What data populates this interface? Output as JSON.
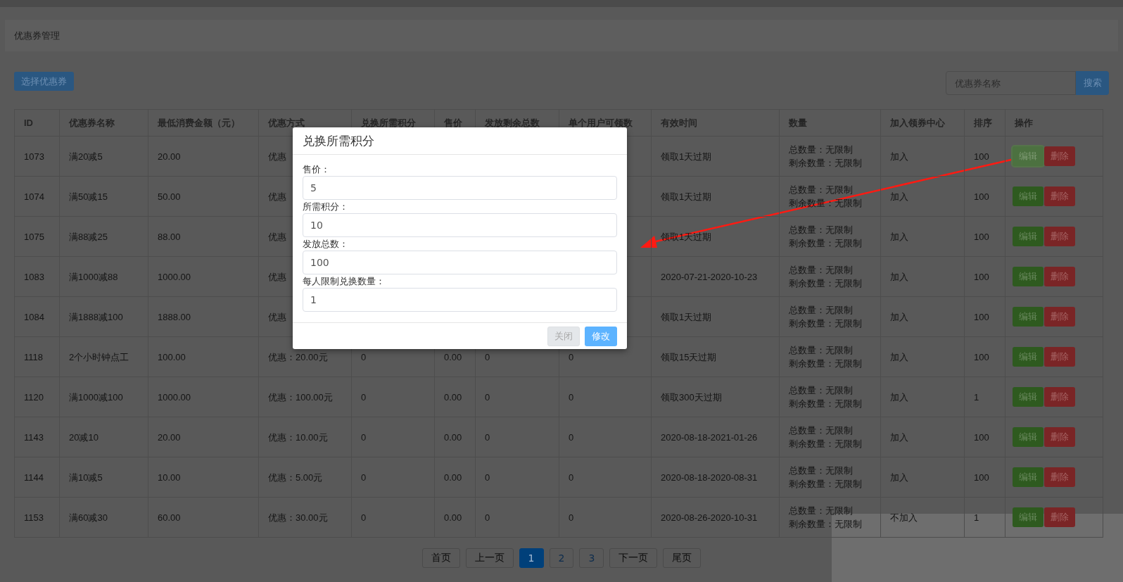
{
  "page_title": "优惠券管理",
  "toolbar": {
    "select_button": "选择优惠券",
    "search": {
      "placeholder": "优惠券名称",
      "button": "搜索"
    }
  },
  "table": {
    "columns": [
      "ID",
      "优惠券名称",
      "最低消费金额（元）",
      "优惠方式",
      "兑换所需积分",
      "售价",
      "发放剩余总数",
      "单个用户可领数",
      "有效时间",
      "数量",
      "加入领券中心",
      "排序",
      "操作"
    ],
    "rows": [
      {
        "id": "1073",
        "name": "满20减5",
        "min_amount": "20.00",
        "discount": "优惠",
        "valid": "领取1天过期",
        "quantity": [
          "总数量：无限制",
          "剩余数量：无限制"
        ],
        "join_center": "加入",
        "sort": "100",
        "actions": [
          {
            "label": "编辑",
            "kind": "edit",
            "focused": true
          },
          {
            "label": "删除",
            "kind": "delete",
            "focused": false
          }
        ]
      },
      {
        "id": "1074",
        "name": "满50减15",
        "min_amount": "50.00",
        "discount": "优惠",
        "valid": "领取1天过期",
        "quantity": [
          "总数量：无限制",
          "剩余数量：无限制"
        ],
        "join_center": "加入",
        "sort": "100",
        "actions": [
          {
            "label": "编辑",
            "kind": "edit",
            "focused": false
          },
          {
            "label": "删除",
            "kind": "delete",
            "focused": false
          }
        ]
      },
      {
        "id": "1075",
        "name": "满88减25",
        "min_amount": "88.00",
        "discount": "优惠",
        "valid": "领取1天过期",
        "quantity": [
          "总数量：无限制",
          "剩余数量：无限制"
        ],
        "join_center": "加入",
        "sort": "100",
        "actions": [
          {
            "label": "编辑",
            "kind": "edit",
            "focused": false
          },
          {
            "label": "删除",
            "kind": "delete",
            "focused": false
          }
        ]
      },
      {
        "id": "1083",
        "name": "满1000减88",
        "min_amount": "1000.00",
        "discount": "优惠",
        "valid": "2020-07-21-2020-10-23",
        "quantity": [
          "总数量：无限制",
          "剩余数量：无限制"
        ],
        "join_center": "加入",
        "sort": "100",
        "actions": [
          {
            "label": "编辑",
            "kind": "edit",
            "focused": false
          },
          {
            "label": "删除",
            "kind": "delete",
            "focused": false
          }
        ]
      },
      {
        "id": "1084",
        "name": "满1888减100",
        "min_amount": "1888.00",
        "discount": "优惠",
        "valid": "领取1天过期",
        "quantity": [
          "总数量：无限制",
          "剩余数量：无限制"
        ],
        "join_center": "加入",
        "sort": "100",
        "actions": [
          {
            "label": "编辑",
            "kind": "edit",
            "focused": false
          },
          {
            "label": "删除",
            "kind": "delete",
            "focused": false
          }
        ]
      },
      {
        "id": "1118",
        "name": "2个小时钟点工",
        "min_amount": "100.00",
        "discount": "优惠：20.00元",
        "points": "0",
        "price": "0.00",
        "remaining": "0",
        "per_user": "0",
        "valid": "领取15天过期",
        "quantity": [
          "总数量：无限制",
          "剩余数量：无限制"
        ],
        "join_center": "加入",
        "sort": "100",
        "actions": [
          {
            "label": "编辑",
            "kind": "edit",
            "focused": false
          },
          {
            "label": "删除",
            "kind": "delete",
            "focused": false
          }
        ]
      },
      {
        "id": "1120",
        "name": "满1000减100",
        "min_amount": "1000.00",
        "discount": "优惠：100.00元",
        "points": "0",
        "price": "0.00",
        "remaining": "0",
        "per_user": "0",
        "valid": "领取300天过期",
        "quantity": [
          "总数量：无限制",
          "剩余数量：无限制"
        ],
        "join_center": "加入",
        "sort": "1",
        "actions": [
          {
            "label": "编辑",
            "kind": "edit",
            "focused": false
          },
          {
            "label": "删除",
            "kind": "delete",
            "focused": false
          }
        ]
      },
      {
        "id": "1143",
        "name": "20减10",
        "min_amount": "20.00",
        "discount": "优惠：10.00元",
        "points": "0",
        "price": "0.00",
        "remaining": "0",
        "per_user": "0",
        "valid": "2020-08-18-2021-01-26",
        "quantity": [
          "总数量：无限制",
          "剩余数量：无限制"
        ],
        "join_center": "加入",
        "sort": "100",
        "actions": [
          {
            "label": "编辑",
            "kind": "edit",
            "focused": false
          },
          {
            "label": "删除",
            "kind": "delete",
            "focused": false
          }
        ]
      },
      {
        "id": "1144",
        "name": "满10减5",
        "min_amount": "10.00",
        "discount": "优惠：5.00元",
        "points": "0",
        "price": "0.00",
        "remaining": "0",
        "per_user": "0",
        "valid": "2020-08-18-2020-08-31",
        "quantity": [
          "总数量：无限制",
          "剩余数量：无限制"
        ],
        "join_center": "加入",
        "sort": "100",
        "actions": [
          {
            "label": "编辑",
            "kind": "edit",
            "focused": false
          },
          {
            "label": "删除",
            "kind": "delete",
            "focused": false
          }
        ]
      },
      {
        "id": "1153",
        "name": "满60减30",
        "min_amount": "60.00",
        "discount": "优惠：30.00元",
        "points": "0",
        "price": "0.00",
        "remaining": "0",
        "per_user": "0",
        "valid": "2020-08-26-2020-10-31",
        "quantity": [
          "总数量：无限制",
          "剩余数量：无限制"
        ],
        "join_center": "不加入",
        "sort": "1",
        "actions": [
          {
            "label": "编辑",
            "kind": "edit",
            "focused": false
          },
          {
            "label": "删除",
            "kind": "delete",
            "focused": false
          }
        ]
      }
    ]
  },
  "pagination": [
    {
      "label": "首页",
      "kind": "nav",
      "selected": false
    },
    {
      "label": "上一页",
      "kind": "nav",
      "selected": false
    },
    {
      "label": "1",
      "kind": "page",
      "selected": true
    },
    {
      "label": "2",
      "kind": "page",
      "selected": false
    },
    {
      "label": "3",
      "kind": "page",
      "selected": false
    },
    {
      "label": "下一页",
      "kind": "nav",
      "selected": false
    },
    {
      "label": "尾页",
      "kind": "nav",
      "selected": false
    }
  ],
  "modal": {
    "title": "兑换所需积分",
    "fields": [
      {
        "label": "售价：",
        "value": "5"
      },
      {
        "label": "所需积分：",
        "value": "10"
      },
      {
        "label": "发放总数：",
        "value": "100"
      },
      {
        "label": "每人限制兑换数量：",
        "value": "1"
      }
    ],
    "buttons": [
      {
        "label": "关闭",
        "kind": "default"
      },
      {
        "label": "修改",
        "kind": "primary"
      }
    ]
  }
}
